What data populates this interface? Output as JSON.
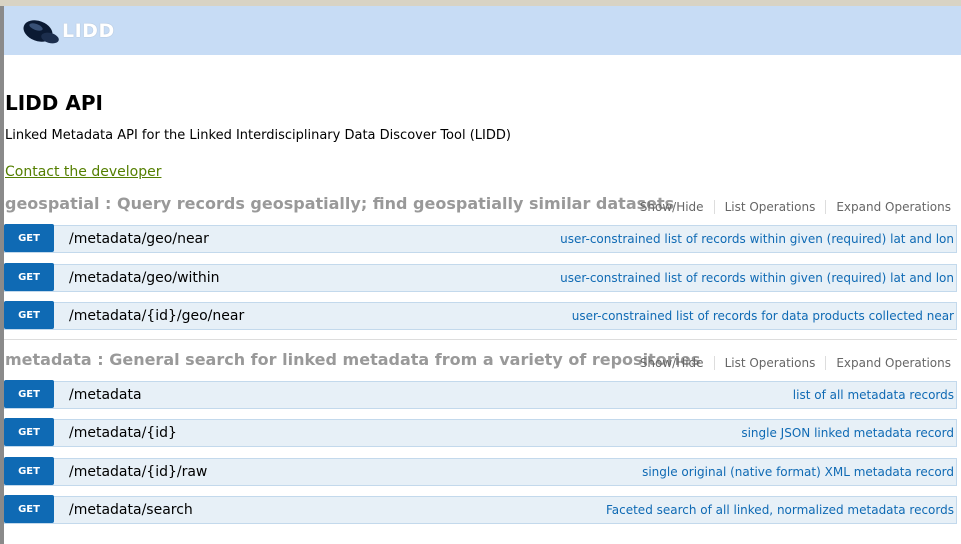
{
  "header": {
    "logo_text": "LIDD"
  },
  "page": {
    "title": "LIDD API",
    "subtitle": "Linked Metadata API for the Linked Interdisciplinary Data Discover Tool (LIDD)",
    "contact_link": "Contact the developer"
  },
  "sections": [
    {
      "title": "geospatial : Query records geospatially; find geospatially similar datasets",
      "ops": [
        "Show/Hide",
        "List Operations",
        "Expand Operations"
      ],
      "endpoints": [
        {
          "method": "GET",
          "path": "/metadata/geo/near",
          "description": "user-constrained list of records within given (required) lat and lon"
        },
        {
          "method": "GET",
          "path": "/metadata/geo/within",
          "description": "user-constrained list of records within given (required) lat and lon"
        },
        {
          "method": "GET",
          "path": "/metadata/{id}/geo/near",
          "description": "user-constrained list of records for data products collected near"
        }
      ]
    },
    {
      "title": "metadata : General search for linked metadata from a variety of repositories",
      "ops": [
        "Show/Hide",
        "List Operations",
        "Expand Operations"
      ],
      "endpoints": [
        {
          "method": "GET",
          "path": "/metadata",
          "description": "list of all metadata records"
        },
        {
          "method": "GET",
          "path": "/metadata/{id}",
          "description": "single JSON linked metadata record"
        },
        {
          "method": "GET",
          "path": "/metadata/{id}/raw",
          "description": "single original (native format) XML metadata record"
        },
        {
          "method": "GET",
          "path": "/metadata/search",
          "description": "Faceted search of all linked, normalized metadata records"
        }
      ]
    }
  ],
  "colors": {
    "header_bg": "#c7dcf5",
    "get_button": "#0f6ab4",
    "endpoint_bg": "#e7f0f7",
    "link_green": "#547f00"
  },
  "icons": {
    "logo": "cap-logo-icon"
  }
}
